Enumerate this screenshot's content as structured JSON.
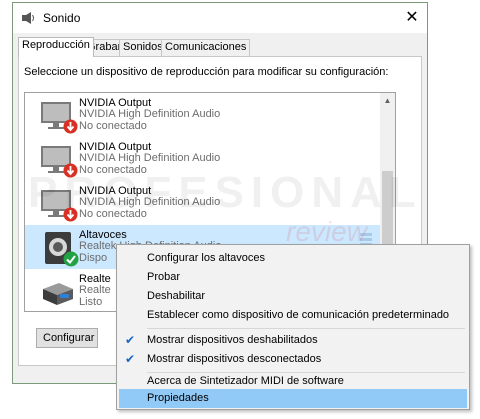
{
  "window": {
    "title": "Sonido",
    "close": "✕"
  },
  "tabs": [
    {
      "label": "Reproducción",
      "active": true
    },
    {
      "label": "Grabar"
    },
    {
      "label": "Sonidos"
    },
    {
      "label": "Comunicaciones"
    }
  ],
  "instruction": "Seleccione un dispositivo de reproducción para modificar su configuración:",
  "devices": [
    {
      "name": "NVIDIA Output",
      "desc": "NVIDIA High Definition Audio",
      "status": "No conectado",
      "icon": "monitor-icon",
      "badge": "disconnected"
    },
    {
      "name": "NVIDIA Output",
      "desc": "NVIDIA High Definition Audio",
      "status": "No conectado",
      "icon": "monitor-icon",
      "badge": "disconnected"
    },
    {
      "name": "NVIDIA Output",
      "desc": "NVIDIA High Definition Audio",
      "status": "No conectado",
      "icon": "monitor-icon",
      "badge": "disconnected"
    },
    {
      "name": "Altavoces",
      "desc": "Realtek High Definition Audio",
      "status": "Dispo",
      "icon": "speaker-icon",
      "badge": "default"
    },
    {
      "name": "Realte",
      "desc": "Realte",
      "status": "Listo",
      "icon": "digital-output-icon",
      "badge": "none"
    }
  ],
  "buttons": {
    "configure": "Configurar"
  },
  "watermark": {
    "main": "PROFESIONAL",
    "sub": "review"
  },
  "context_menu": {
    "items": [
      {
        "label": "Configurar los altavoces"
      },
      {
        "label": "Probar"
      },
      {
        "label": "Deshabilitar"
      },
      {
        "label": "Establecer como dispositivo de comunicación predeterminado"
      },
      {
        "label": "Mostrar dispositivos deshabilitados",
        "checked": true
      },
      {
        "label": "Mostrar dispositivos desconectados",
        "checked": true
      },
      {
        "label": "Acerca de Sintetizador MIDI de software"
      },
      {
        "label": "Propiedades",
        "highlighted": true
      }
    ]
  },
  "colors": {
    "selection": "#cce8ff",
    "menu_highlight": "#91c9f7",
    "disconnected_badge": "#d93025",
    "default_badge": "#21a244"
  }
}
